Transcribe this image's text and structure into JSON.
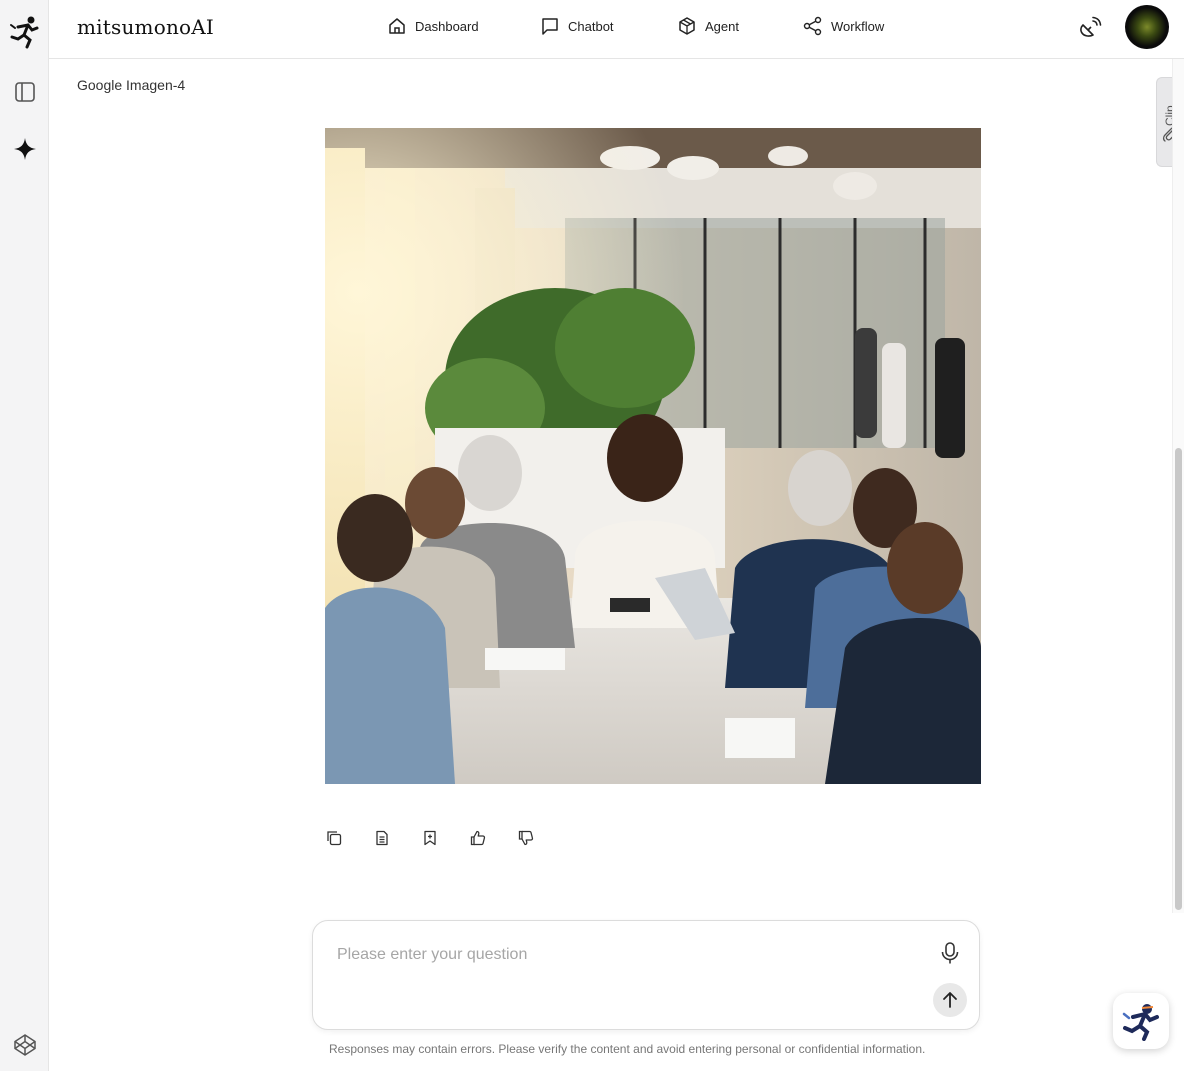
{
  "app": {
    "brand": "mitsumonoAI"
  },
  "nav": {
    "items": [
      {
        "label": "Dashboard",
        "icon": "home-icon"
      },
      {
        "label": "Chatbot",
        "icon": "chat-icon"
      },
      {
        "label": "Agent",
        "icon": "cube-icon"
      },
      {
        "label": "Workflow",
        "icon": "share-icon"
      }
    ]
  },
  "sidebar": {
    "icons": [
      "logo-runner-icon",
      "sidebar-toggle-icon",
      "sparkle-icon",
      "codepen-icon"
    ]
  },
  "main": {
    "model_label": "Google Imagen-4",
    "image_alt": "Generated image: business team meeting around a table in a bright office",
    "actions": [
      "copy-icon",
      "document-icon",
      "bookmark-add-icon",
      "thumbs-up-icon",
      "thumbs-down-icon"
    ]
  },
  "clip": {
    "label": "Clip"
  },
  "composer": {
    "placeholder": "Please enter your question",
    "disclaimer": "Responses may contain errors. Please verify the content and avoid entering personal or confidential information."
  },
  "colors": {
    "sidebar_bg": "#f4f4f5",
    "accent_dark": "#1e2a5a"
  }
}
